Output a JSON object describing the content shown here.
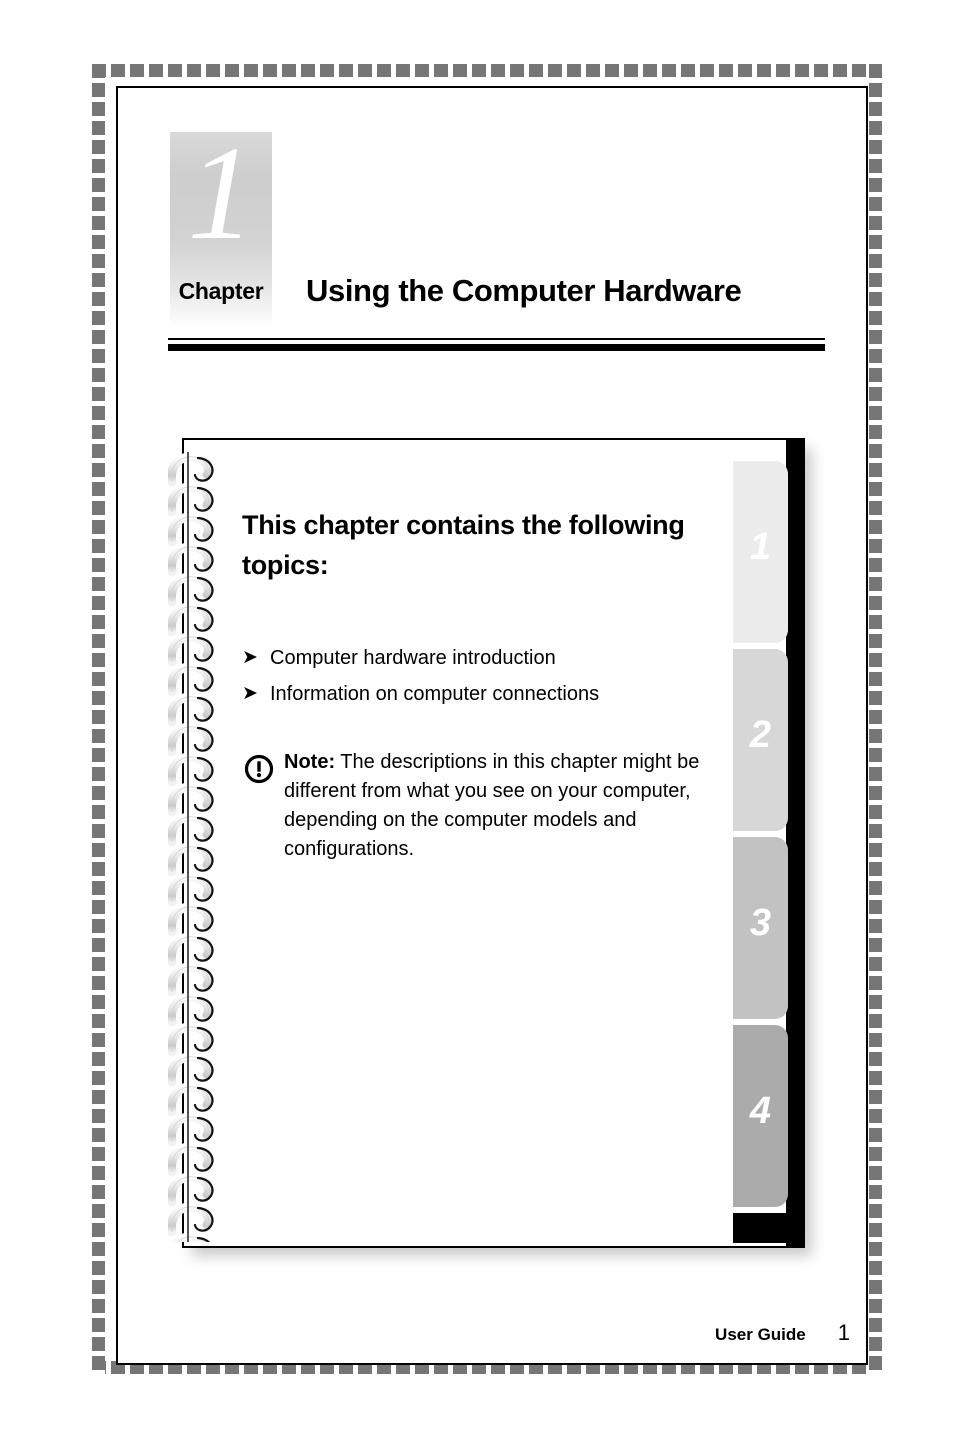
{
  "document": {
    "chapter_number": "1",
    "chapter_word": "Chapter",
    "chapter_title": "Using the Computer Hardware"
  },
  "card": {
    "heading": "This chapter contains the following topics:",
    "topics": [
      {
        "bullet": "➜",
        "label": "Computer hardware introduction"
      },
      {
        "bullet": "➜",
        "label": "Information on computer connections"
      }
    ],
    "note": {
      "icon_name": "exclamation-circle-icon",
      "label": "Note:",
      "text": " The descriptions in this chapter might be different from what you see on your computer, depending on the computer models and configurations."
    }
  },
  "tabs": [
    {
      "number": "1",
      "color": "#ececec"
    },
    {
      "number": "2",
      "color": "#d7d7d7"
    },
    {
      "number": "3",
      "color": "#c2c2c2"
    },
    {
      "number": "4",
      "color": "#ababab"
    }
  ],
  "footer": {
    "label": "User Guide",
    "page": "1"
  },
  "colors": {
    "frame_dash": "#767676",
    "ink": "#000000",
    "spine": "#000000"
  }
}
